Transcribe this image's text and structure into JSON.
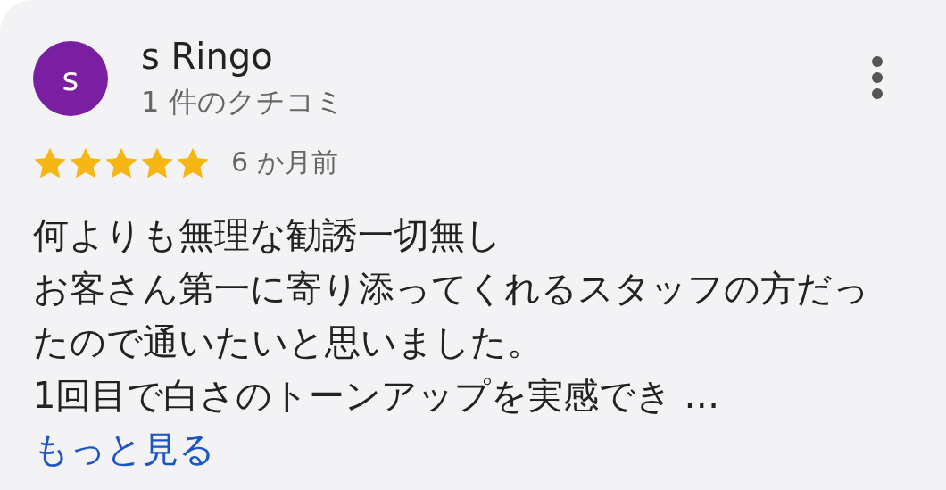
{
  "review": {
    "avatar_letter": "s",
    "author": "s Ringo",
    "review_count": "1 件のクチコミ",
    "stars": 5,
    "time": "6 か月前",
    "paragraphs": [
      "何よりも無理な勧誘一切無し",
      "お客さん第一に寄り添ってくれるスタッフの方だったので通いたいと思いました。",
      "1回目で白さのトーンアップを実感でき …"
    ],
    "more_link": "もっと見る"
  }
}
